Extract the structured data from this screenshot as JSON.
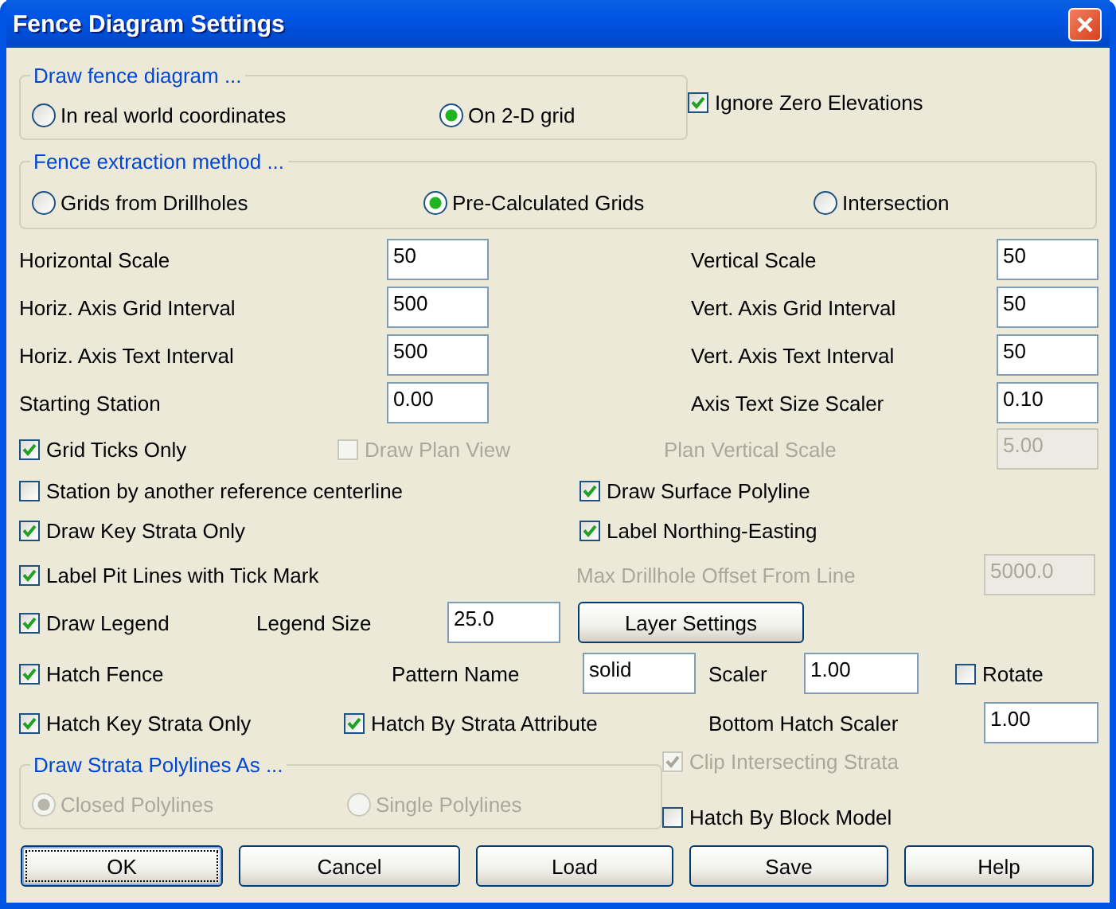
{
  "window": {
    "title": "Fence Diagram Settings"
  },
  "rows": [
    [
      {
        "kind": "group",
        "title": "Draw fence diagram ...",
        "disabled": false,
        "options": [
          {
            "label": "In real world coordinates",
            "selected": false
          },
          {
            "label": "On 2-D grid",
            "selected": true
          }
        ]
      },
      {
        "kind": "check",
        "label": "Ignore Zero Elevations",
        "checked": true,
        "disabled": false
      }
    ],
    [
      {
        "kind": "group",
        "title": "Fence extraction method ...",
        "disabled": false,
        "options": [
          {
            "label": "Grids from Drillholes",
            "selected": false
          },
          {
            "label": "Pre-Calculated Grids",
            "selected": true
          },
          {
            "label": "Intersection",
            "selected": false
          }
        ]
      }
    ],
    [
      {
        "kind": "field",
        "label": "Horizontal Scale",
        "value": "50",
        "disabled": false
      },
      {
        "kind": "field",
        "label": "Vertical Scale",
        "value": "50",
        "disabled": false
      }
    ],
    [
      {
        "kind": "field",
        "label": "Horiz. Axis Grid Interval",
        "value": "500",
        "disabled": false
      },
      {
        "kind": "field",
        "label": "Vert. Axis Grid Interval",
        "value": "50",
        "disabled": false
      }
    ],
    [
      {
        "kind": "field",
        "label": "Horiz. Axis Text Interval",
        "value": "500",
        "disabled": false
      },
      {
        "kind": "field",
        "label": "Vert. Axis Text Interval",
        "value": "50",
        "disabled": false
      }
    ],
    [
      {
        "kind": "field",
        "label": "Starting Station",
        "value": "0.00",
        "disabled": false
      },
      {
        "kind": "field",
        "label": "Axis Text Size Scaler",
        "value": "0.10",
        "disabled": false
      }
    ],
    [
      {
        "kind": "check",
        "label": "Grid Ticks Only",
        "checked": true,
        "disabled": false
      },
      {
        "kind": "check",
        "label": "Draw Plan View",
        "checked": false,
        "disabled": true
      },
      {
        "kind": "field",
        "label": "Plan Vertical Scale",
        "value": "5.00",
        "disabled": true
      }
    ],
    [
      {
        "kind": "check",
        "label": "Station by another reference centerline",
        "checked": false,
        "disabled": false
      },
      {
        "kind": "check",
        "label": "Draw Surface Polyline",
        "checked": true,
        "disabled": false
      }
    ],
    [
      {
        "kind": "check",
        "label": "Draw Key Strata Only",
        "checked": true,
        "disabled": false
      },
      {
        "kind": "check",
        "label": "Label Northing-Easting",
        "checked": true,
        "disabled": false
      }
    ],
    [
      {
        "kind": "check",
        "label": "Label Pit Lines with Tick Mark",
        "checked": true,
        "disabled": false
      },
      {
        "kind": "field",
        "label": "Max Drillhole Offset From Line",
        "value": "5000.0",
        "disabled": true
      }
    ],
    [
      {
        "kind": "check",
        "label": "Draw Legend",
        "checked": true,
        "disabled": false
      },
      {
        "kind": "field",
        "label": "Legend Size",
        "value": "25.0",
        "disabled": false
      },
      {
        "kind": "button",
        "label": "Layer Settings",
        "default": false
      }
    ],
    [
      {
        "kind": "check",
        "label": "Hatch Fence",
        "checked": true,
        "disabled": false
      },
      {
        "kind": "field",
        "label": "Pattern Name",
        "value": "solid",
        "disabled": false
      },
      {
        "kind": "field",
        "label": "Scaler",
        "value": "1.00",
        "disabled": false
      },
      {
        "kind": "check",
        "label": "Rotate",
        "checked": false,
        "disabled": false
      }
    ],
    [
      {
        "kind": "check",
        "label": "Hatch Key Strata Only",
        "checked": true,
        "disabled": false
      },
      {
        "kind": "check",
        "label": "Hatch By Strata Attribute",
        "checked": true,
        "disabled": false
      },
      {
        "kind": "field",
        "label": "Bottom Hatch Scaler",
        "value": "1.00",
        "disabled": false
      }
    ],
    [
      {
        "kind": "group",
        "title": "Draw Strata Polylines As ...",
        "disabled": true,
        "options": [
          {
            "label": "Closed Polylines",
            "selected": true
          },
          {
            "label": "Single Polylines",
            "selected": false
          }
        ]
      },
      {
        "kind": "stack",
        "items": [
          {
            "kind": "check",
            "label": "Clip Intersecting Strata",
            "checked": true,
            "disabled": true
          },
          {
            "kind": "check",
            "label": "Hatch By Block Model",
            "checked": false,
            "disabled": false
          }
        ]
      }
    ]
  ],
  "buttons": [
    {
      "label": "OK",
      "default": true
    },
    {
      "label": "Cancel",
      "default": false
    },
    {
      "label": "Load",
      "default": false
    },
    {
      "label": "Save",
      "default": false
    },
    {
      "label": "Help",
      "default": false
    }
  ]
}
